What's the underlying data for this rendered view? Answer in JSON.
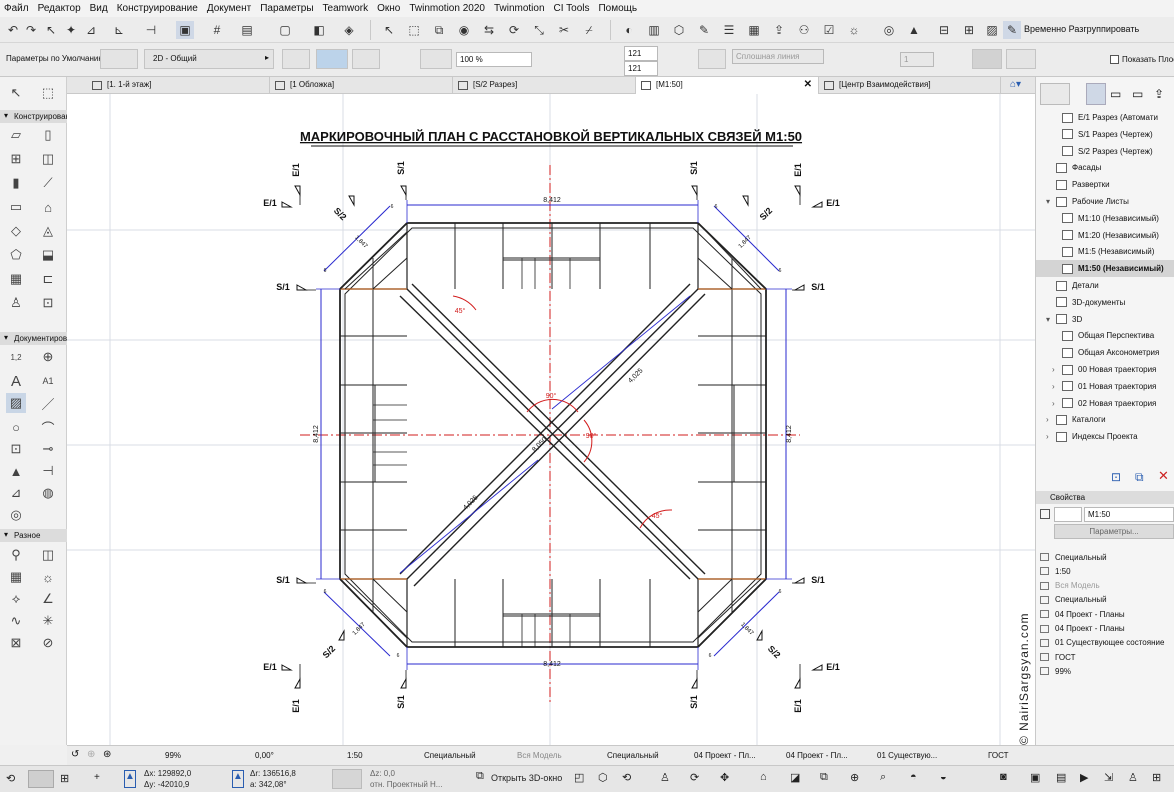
{
  "menu": [
    "Файл",
    "Редактор",
    "Вид",
    "Конструирование",
    "Документ",
    "Параметры",
    "Teamwork",
    "Окно",
    "Twinmotion 2020",
    "Twinmotion",
    "CI Tools",
    "Помощь"
  ],
  "toolbar": {
    "group_ungroup": "Временно Разгруппировать",
    "default_params": "Параметры по Умолчанию",
    "view_dropdown": "2D - Общий",
    "fill_percent": "100 %",
    "pen_a": "121",
    "pen_b": "121",
    "line_type": "Сплошная линия",
    "layer_value": "1",
    "show_label": "Показать Плос"
  },
  "tabs": [
    {
      "label": "[1. 1-й этаж]"
    },
    {
      "label": "[1 Обложка]"
    },
    {
      "label": "[S/2 Разрез]"
    },
    {
      "label": "[M1:50]"
    },
    {
      "label": "[Центр Взаимодействия]"
    }
  ],
  "left_panel": {
    "section_construct": "Конструирование",
    "section_document": "Документирование",
    "section_misc": "Разное",
    "label_a1": "A1",
    "label_12": "1,2"
  },
  "drawing": {
    "title": "МАРКИРОВОЧНЫЙ ПЛАН С РАССТАНОВКОЙ  ВЕРТИКАЛЬНЫХ СВЯЗЕЙ М1:50",
    "dim_main": "8,412",
    "dim_diag": "1,847",
    "dim_brace": "4,025",
    "dim_center": "8,050",
    "angle_45": "45°",
    "angle_90": "90°",
    "mark_e1": "E/1",
    "mark_s1": "S/1",
    "mark_s2": "S/2",
    "mark_6": "6"
  },
  "navigator": [
    {
      "label": "E/1 Разрез (Автомати",
      "indent": 2,
      "arrow": "",
      "sel": false
    },
    {
      "label": "S/1 Разрез (Чертеж)",
      "indent": 2,
      "arrow": "",
      "sel": false
    },
    {
      "label": "S/2 Разрез (Чертеж)",
      "indent": 2,
      "arrow": "",
      "sel": false
    },
    {
      "label": "Фасады",
      "indent": 1,
      "arrow": "",
      "sel": false
    },
    {
      "label": "Развертки",
      "indent": 1,
      "arrow": "",
      "sel": false
    },
    {
      "label": "Рабочие Листы",
      "indent": 1,
      "arrow": "▾",
      "sel": false
    },
    {
      "label": "M1:10 (Независимый)",
      "indent": 2,
      "arrow": "",
      "sel": false
    },
    {
      "label": "M1:20 (Независимый)",
      "indent": 2,
      "arrow": "",
      "sel": false
    },
    {
      "label": "M1:5 (Независимый)",
      "indent": 2,
      "arrow": "",
      "sel": false
    },
    {
      "label": "M1:50 (Независимый)",
      "indent": 2,
      "arrow": "",
      "sel": true
    },
    {
      "label": "Детали",
      "indent": 1,
      "arrow": "",
      "sel": false
    },
    {
      "label": "3D-документы",
      "indent": 1,
      "arrow": "",
      "sel": false
    },
    {
      "label": "3D",
      "indent": 1,
      "arrow": "▾",
      "sel": false
    },
    {
      "label": "Общая Перспектива",
      "indent": 2,
      "arrow": "",
      "sel": false
    },
    {
      "label": "Общая Аксонометрия",
      "indent": 2,
      "arrow": "",
      "sel": false
    },
    {
      "label": "00 Новая траектория",
      "indent": 2,
      "arrow": "›",
      "sel": false
    },
    {
      "label": "01 Новая траектория",
      "indent": 2,
      "arrow": "›",
      "sel": false
    },
    {
      "label": "02 Новая траектория",
      "indent": 2,
      "arrow": "›",
      "sel": false
    },
    {
      "label": "Каталоги",
      "indent": 1,
      "arrow": "›",
      "sel": false
    },
    {
      "label": "Индексы Проекта",
      "indent": 1,
      "arrow": "›",
      "sel": false
    }
  ],
  "properties": {
    "header": "Свойства",
    "name": "M1:50",
    "params_button": "Параметры...",
    "rows": [
      "Специальный",
      "1:50",
      "Вся Модель",
      "Специальный",
      "04 Проект - Планы",
      "04 Проект - Планы",
      "01 Существующее состояние",
      "ГОСТ",
      "99%"
    ]
  },
  "watermark": "© NairiSargsyan.com",
  "status": {
    "zoom": "99%",
    "angle": "0,00°",
    "scale": "1:50",
    "structure": "Специальный",
    "model": "Вся Модель",
    "pen_set": "Специальный",
    "layer_combo": "04 Проект - Пл...",
    "view_combo": "04 Проект - Пл...",
    "renovation": "01 Существую...",
    "standard": "ГОСТ"
  },
  "coords": {
    "dx": "Δx: 129892,0",
    "dy": "Δy: -42010,9",
    "dr": "Δr: 136516,8",
    "da": "a: 342,08°",
    "dz": "Δz: 0,0",
    "ref": "отн. Проектный Н...",
    "open3d": "Открыть 3D-окно"
  },
  "colors": {
    "blue": "#2a2acf",
    "red": "#d21c1c",
    "dark": "#222222",
    "grid": "#d8dce4"
  }
}
